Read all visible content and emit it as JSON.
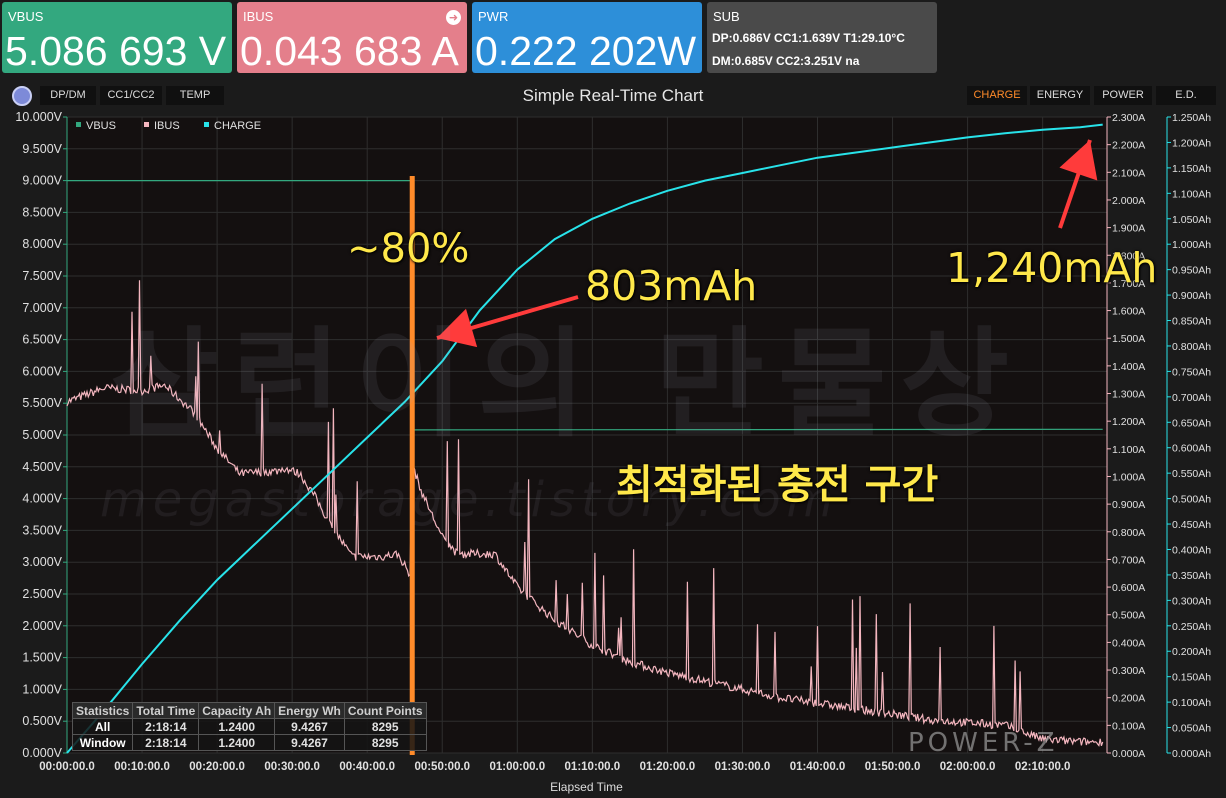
{
  "tiles": {
    "vbus": {
      "label": "VBUS",
      "value": "5.086 693 V"
    },
    "ibus": {
      "label": "IBUS",
      "value": "0.043 683 A"
    },
    "pwr": {
      "label": "PWR",
      "value": "0.222 202W"
    },
    "sub": {
      "label": "SUB",
      "line1": "DP:0.686V   CC1:1.639V   T1:29.10°C",
      "line2": "DM:0.685V   CC2:3.251V   na"
    }
  },
  "toolbar": {
    "left_tabs": [
      "DP/DM",
      "CC1/CC2",
      "TEMP"
    ],
    "right_tabs": [
      "CHARGE",
      "ENERGY",
      "POWER",
      "E.D."
    ],
    "active_right": "CHARGE",
    "title": "Simple Real-Time Chart"
  },
  "colors": {
    "vbus": "#33a87f",
    "ibus": "#f4b6bf",
    "charge": "#28e3ea",
    "marker": "#ff8b2a",
    "annotation": "#ffe84a",
    "arrow": "#ff3b3b"
  },
  "chart_data": {
    "type": "line",
    "title": "Simple Real-Time Chart",
    "xlabel": "Elapsed Time",
    "x_ticks": [
      "00:00:00.0",
      "00:10:00.0",
      "00:20:00.0",
      "00:30:00.0",
      "00:40:00.0",
      "00:50:00.0",
      "01:00:00.0",
      "01:10:00.0",
      "01:20:00.0",
      "01:30:00.0",
      "01:40:00.0",
      "01:50:00.0",
      "02:00:00.0",
      "02:10:00.0"
    ],
    "x_minutes_range": [
      0,
      138
    ],
    "y_left": {
      "unit": "V",
      "range": [
        0,
        10
      ],
      "ticks": [
        "0.000V",
        "0.500V",
        "1.000V",
        "1.500V",
        "2.000V",
        "2.500V",
        "3.000V",
        "3.500V",
        "4.000V",
        "4.500V",
        "5.000V",
        "5.500V",
        "6.000V",
        "6.500V",
        "7.000V",
        "7.500V",
        "8.000V",
        "8.500V",
        "9.000V",
        "9.500V",
        "10.000V"
      ]
    },
    "y_mid": {
      "unit": "A",
      "range": [
        0,
        2.3
      ],
      "ticks": [
        "0.000A",
        "0.100A",
        "0.200A",
        "0.300A",
        "0.400A",
        "0.500A",
        "0.600A",
        "0.700A",
        "0.800A",
        "0.900A",
        "1.000A",
        "1.100A",
        "1.200A",
        "1.300A",
        "1.400A",
        "1.500A",
        "1.600A",
        "1.700A",
        "1.800A",
        "1.900A",
        "2.000A",
        "2.100A",
        "2.200A",
        "2.300A"
      ]
    },
    "y_right": {
      "unit": "Ah",
      "range": [
        0,
        1.25
      ],
      "ticks": [
        "0.000Ah",
        "0.050Ah",
        "0.100Ah",
        "0.150Ah",
        "0.200Ah",
        "0.250Ah",
        "0.300Ah",
        "0.350Ah",
        "0.400Ah",
        "0.450Ah",
        "0.500Ah",
        "0.550Ah",
        "0.600Ah",
        "0.650Ah",
        "0.700Ah",
        "0.750Ah",
        "0.800Ah",
        "0.850Ah",
        "0.900Ah",
        "0.950Ah",
        "1.000Ah",
        "1.050Ah",
        "1.100Ah",
        "1.150Ah",
        "1.200Ah",
        "1.250Ah"
      ]
    },
    "legend": [
      "VBUS",
      "IBUS",
      "CHARGE"
    ],
    "legend_placement": "top-left",
    "grid": true,
    "series": [
      {
        "name": "VBUS",
        "axis": "left",
        "x": [
          0,
          46,
          46,
          138
        ],
        "values": [
          9.0,
          9.0,
          5.08,
          5.09
        ]
      },
      {
        "name": "IBUS",
        "axis": "mid",
        "x": [
          0,
          5,
          10,
          13,
          17,
          20,
          23,
          28,
          29,
          31,
          33,
          35,
          38,
          42,
          44,
          45,
          45.7,
          46,
          47,
          50,
          52,
          55,
          57,
          60,
          65,
          70,
          75,
          80,
          85,
          90,
          95,
          100,
          105,
          110,
          115,
          120,
          125,
          130,
          135,
          138
        ],
        "values": [
          1.27,
          1.32,
          1.31,
          1.33,
          1.23,
          1.1,
          1.01,
          1.02,
          1.03,
          1.01,
          0.93,
          0.83,
          0.71,
          0.71,
          0.72,
          0.68,
          0.64,
          1.05,
          0.96,
          0.78,
          0.72,
          0.72,
          0.72,
          0.6,
          0.48,
          0.39,
          0.33,
          0.29,
          0.26,
          0.23,
          0.2,
          0.18,
          0.16,
          0.14,
          0.12,
          0.11,
          0.1,
          0.05,
          0.04,
          0.04
        ]
      },
      {
        "name": "CHARGE",
        "axis": "right",
        "x": [
          0,
          5,
          10,
          15,
          20,
          25,
          30,
          35,
          40,
          45,
          50,
          55,
          60,
          65,
          70,
          75,
          80,
          85,
          90,
          95,
          100,
          105,
          110,
          115,
          120,
          125,
          130,
          135,
          138
        ],
        "values": [
          0,
          0.085,
          0.175,
          0.26,
          0.34,
          0.41,
          0.48,
          0.55,
          0.62,
          0.69,
          0.77,
          0.87,
          0.95,
          1.01,
          1.05,
          1.08,
          1.105,
          1.125,
          1.14,
          1.155,
          1.17,
          1.18,
          1.19,
          1.2,
          1.21,
          1.218,
          1.225,
          1.23,
          1.235
        ]
      }
    ]
  },
  "annotations": {
    "pct80": "~80%",
    "mah803": "803mAh",
    "mah1240": "1,240mAh",
    "zone": "최적화된 충전 구간"
  },
  "stats": {
    "headers": [
      "Statistics",
      "Total Time",
      "Capacity Ah",
      "Energy Wh",
      "Count Points"
    ],
    "rows": [
      [
        "All",
        "2:18:14",
        "1.2400",
        "9.4267",
        "8295"
      ],
      [
        "Window",
        "2:18:14",
        "1.2400",
        "9.4267",
        "8295"
      ]
    ]
  },
  "marker_minute": 46
}
